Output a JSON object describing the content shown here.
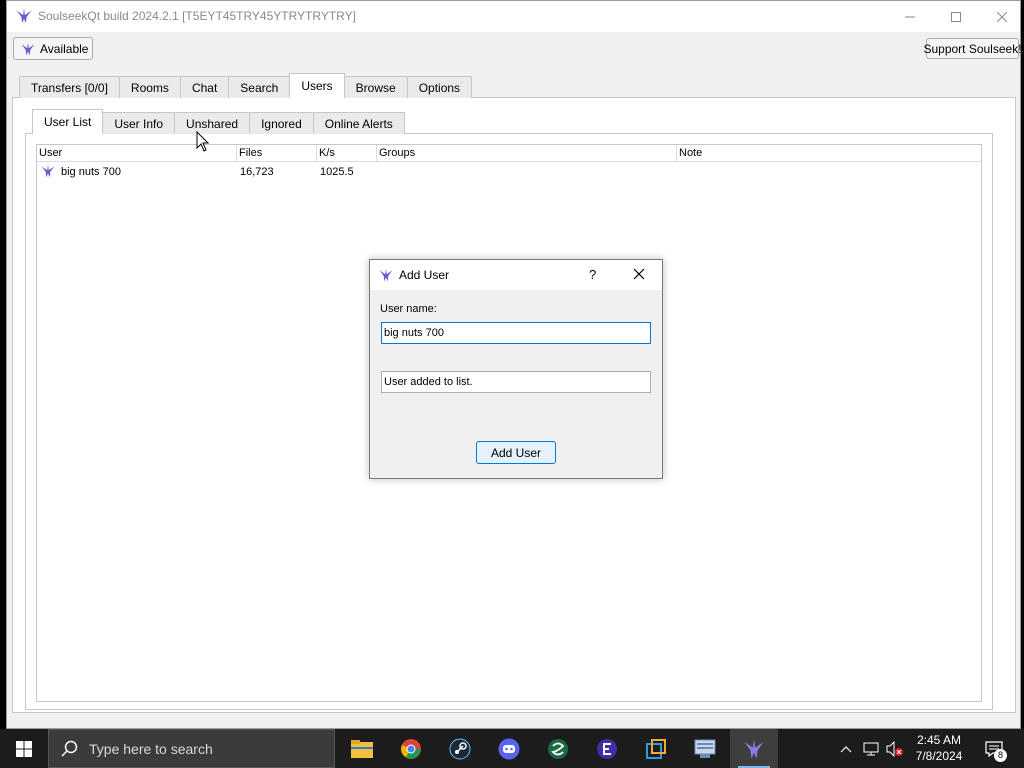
{
  "window": {
    "title": "SoulseekQt build 2024.2.1 [T5EYT45TRY45YTRYTRYTRY]"
  },
  "toolbar": {
    "status_label": "Available",
    "support_label": "Support Soulseek!"
  },
  "main_tabs": [
    {
      "label": "Transfers [0/0]",
      "active": false
    },
    {
      "label": "Rooms",
      "active": false
    },
    {
      "label": "Chat",
      "active": false
    },
    {
      "label": "Search",
      "active": false
    },
    {
      "label": "Users",
      "active": true
    },
    {
      "label": "Browse",
      "active": false
    },
    {
      "label": "Options",
      "active": false
    }
  ],
  "sub_tabs": [
    {
      "label": "User List",
      "active": true
    },
    {
      "label": "User Info",
      "active": false
    },
    {
      "label": "Unshared",
      "active": false
    },
    {
      "label": "Ignored",
      "active": false
    },
    {
      "label": "Online Alerts",
      "active": false
    }
  ],
  "user_table": {
    "columns": [
      "User",
      "Files",
      "K/s",
      "Groups",
      "Note"
    ],
    "rows": [
      {
        "user": "big nuts 700",
        "files": "16,723",
        "speed": "1025.5",
        "groups": "",
        "note": ""
      }
    ]
  },
  "dialog": {
    "title": "Add User",
    "help_label": "?",
    "username_label": "User name:",
    "username_value": "big nuts 700",
    "status_text": "User added to list.",
    "add_button_label": "Add User"
  },
  "taskbar": {
    "search_placeholder": "Type here to search",
    "time": "2:45 AM",
    "date": "7/8/2024",
    "notification_count": "8",
    "pinned_apps": [
      "file-explorer-icon",
      "chrome-icon",
      "steam-icon",
      "discord-icon",
      "app-icon",
      "app-icon",
      "app-icon",
      "app-icon",
      "soulseek-icon"
    ]
  },
  "colors": {
    "accent": "#0078d7",
    "soulseek_bird": "#6b5bd0",
    "taskbar_bg": "#1c1c1c"
  }
}
